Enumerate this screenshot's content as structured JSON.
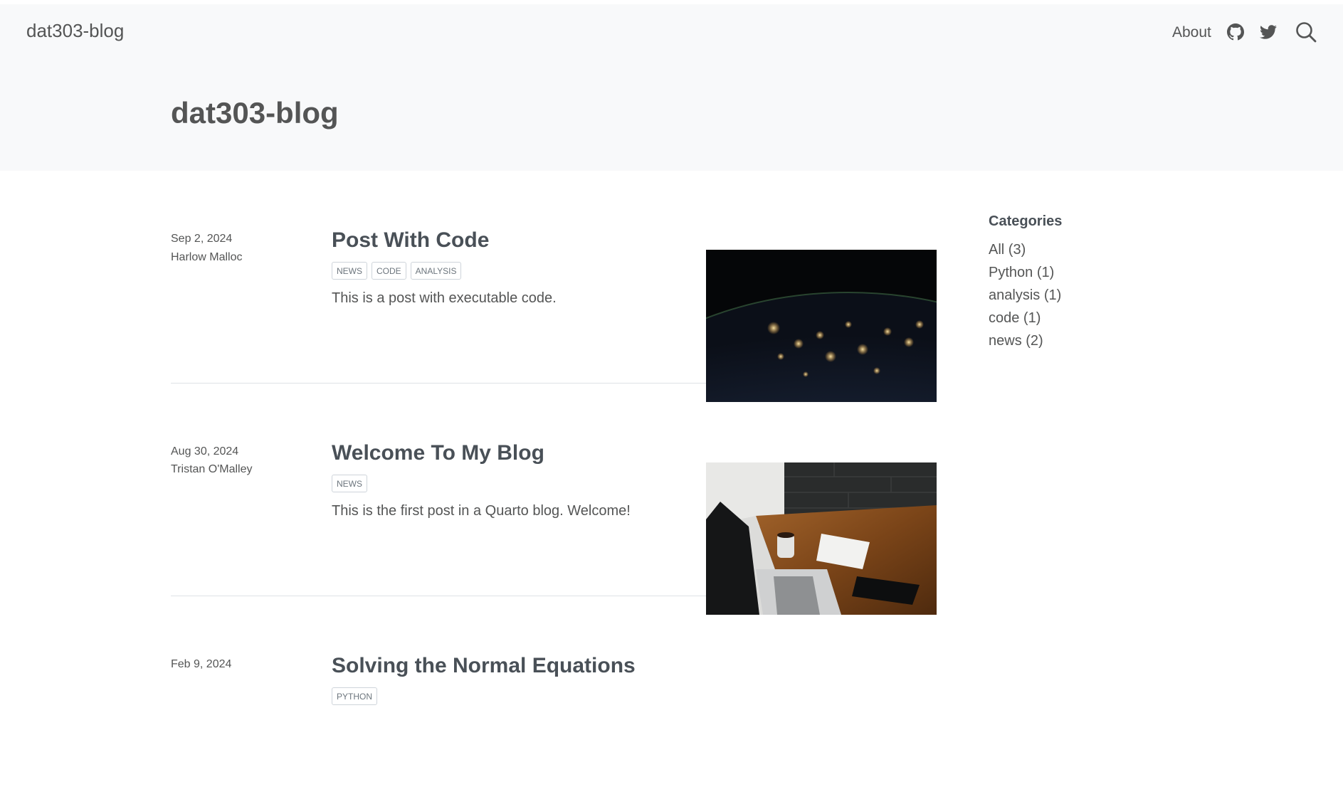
{
  "nav": {
    "brand": "dat303-blog",
    "about": "About",
    "icons": [
      "github-icon",
      "twitter-icon",
      "search-icon"
    ]
  },
  "header": {
    "title": "dat303-blog"
  },
  "posts": [
    {
      "date": "Sep 2, 2024",
      "author": "Harlow Malloc",
      "title": "Post With Code",
      "categories": [
        "NEWS",
        "CODE",
        "ANALYSIS"
      ],
      "description": "This is a post with executable code.",
      "image": "earth-at-night"
    },
    {
      "date": "Aug 30, 2024",
      "author": "Tristan O'Malley",
      "title": "Welcome To My Blog",
      "categories": [
        "NEWS"
      ],
      "description": "This is the first post in a Quarto blog. Welcome!",
      "image": "desk-with-laptop"
    },
    {
      "date": "Feb 9, 2024",
      "author": "",
      "title": "Solving the Normal Equations",
      "categories": [
        "PYTHON"
      ],
      "description": "",
      "image": ""
    }
  ],
  "sidebar": {
    "heading": "Categories",
    "items": [
      "All (3)",
      "Python (1)",
      "analysis (1)",
      "code (1)",
      "news (2)"
    ]
  }
}
